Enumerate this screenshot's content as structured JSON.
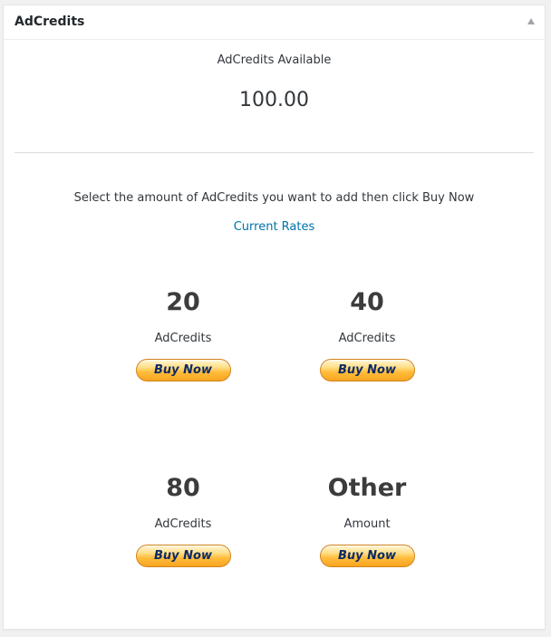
{
  "panel": {
    "title": "AdCredits",
    "toggle_icon": "triangle-up-icon"
  },
  "balance": {
    "label": "AdCredits Available",
    "value": "100.00"
  },
  "purchase": {
    "instructions": "Select the amount of AdCredits you want to add then click Buy Now",
    "rates_link": "Current Rates",
    "options": [
      {
        "amount": "20",
        "unit": "AdCredits",
        "button": "Buy Now"
      },
      {
        "amount": "40",
        "unit": "AdCredits",
        "button": "Buy Now"
      },
      {
        "amount": "80",
        "unit": "AdCredits",
        "button": "Buy Now"
      },
      {
        "amount": "Other",
        "unit": "Amount",
        "button": "Buy Now"
      }
    ]
  },
  "colors": {
    "link": "#0073aa",
    "button_top": "#fff6da",
    "button_bottom": "#f9a51f",
    "button_text": "#0c2a66"
  }
}
